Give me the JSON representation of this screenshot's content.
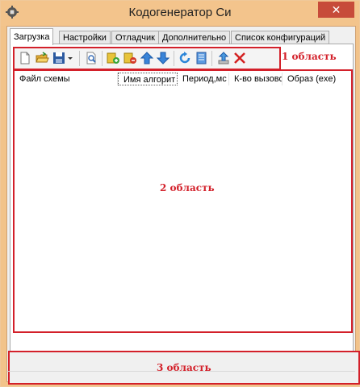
{
  "window": {
    "title": "Кодогенератор Си",
    "close_glyph": "✕"
  },
  "tabs": [
    {
      "label": "Загрузка",
      "active": true
    },
    {
      "label": "Настройки",
      "active": false
    },
    {
      "label": "Отладчик",
      "active": false
    },
    {
      "label": "Дополнительно",
      "active": false
    },
    {
      "label": "Список конфигураций",
      "active": false
    }
  ],
  "toolbar": {
    "icons": [
      "new-file-icon",
      "open-folder-icon",
      "save-icon",
      "save-dropdown-icon",
      "find-icon",
      "add-icon",
      "remove-icon",
      "move-up-icon",
      "move-down-icon",
      "refresh-icon",
      "script-icon",
      "export-icon",
      "delete-icon"
    ]
  },
  "list": {
    "columns": [
      "Файл схемы",
      "Имя алгорит",
      "Период,мс",
      "К-во вызово",
      "Образ (exe)"
    ]
  },
  "annotations": {
    "area1": "1 область",
    "area2": "2 область",
    "area3": "3 область"
  },
  "colors": {
    "annotation_red": "#d3202a",
    "title_bar": "#f3c48c",
    "close_red": "#c74b3a"
  }
}
